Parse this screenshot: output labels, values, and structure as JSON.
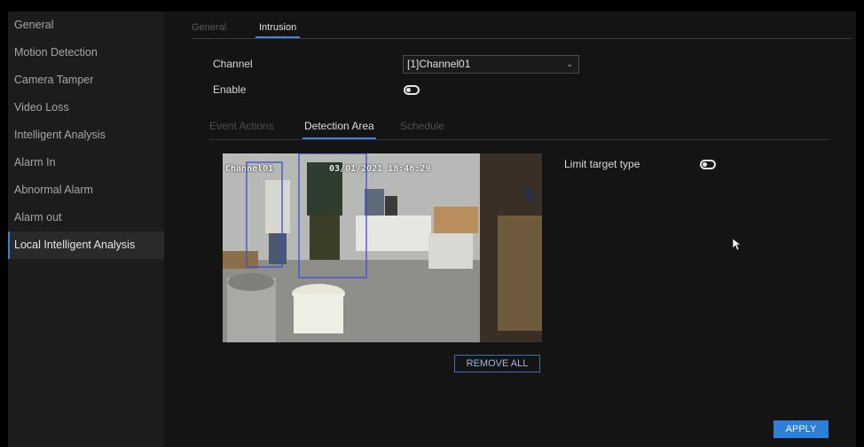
{
  "sidebar": {
    "items": [
      {
        "label": "General"
      },
      {
        "label": "Motion Detection"
      },
      {
        "label": "Camera Tamper"
      },
      {
        "label": "Video Loss"
      },
      {
        "label": "Intelligent Analysis"
      },
      {
        "label": "Alarm In"
      },
      {
        "label": "Abnormal Alarm"
      },
      {
        "label": "Alarm out"
      },
      {
        "label": "Local Intelligent Analysis",
        "active": true
      }
    ]
  },
  "top_tabs": [
    {
      "label": "General",
      "active": false
    },
    {
      "label": "Intrusion",
      "active": true
    }
  ],
  "form": {
    "channel_label": "Channel",
    "channel_value": "[1]Channel01",
    "enable_label": "Enable",
    "enable_on": false
  },
  "sub_tabs": [
    {
      "label": "Event Actions",
      "active": false
    },
    {
      "label": "Detection Area",
      "active": true
    },
    {
      "label": "Schedule",
      "active": false
    }
  ],
  "video": {
    "osd_channel": "Channel01",
    "osd_datetime": "03/01/2021 18:46:29"
  },
  "limit_target_label": "Limit target type",
  "limit_target_on": false,
  "buttons": {
    "remove_all": "REMOVE ALL",
    "apply": "APPLY"
  },
  "colors": {
    "accent": "#3d86e0",
    "apply_bg": "#2d7fd8",
    "background": "#141414",
    "sidebar_bg": "#1c1c1c",
    "detection_box": "#3a4fd0"
  },
  "icons": {
    "channel_dropdown": "chevron-down-icon",
    "pointer": "mouse-pointer-icon"
  }
}
